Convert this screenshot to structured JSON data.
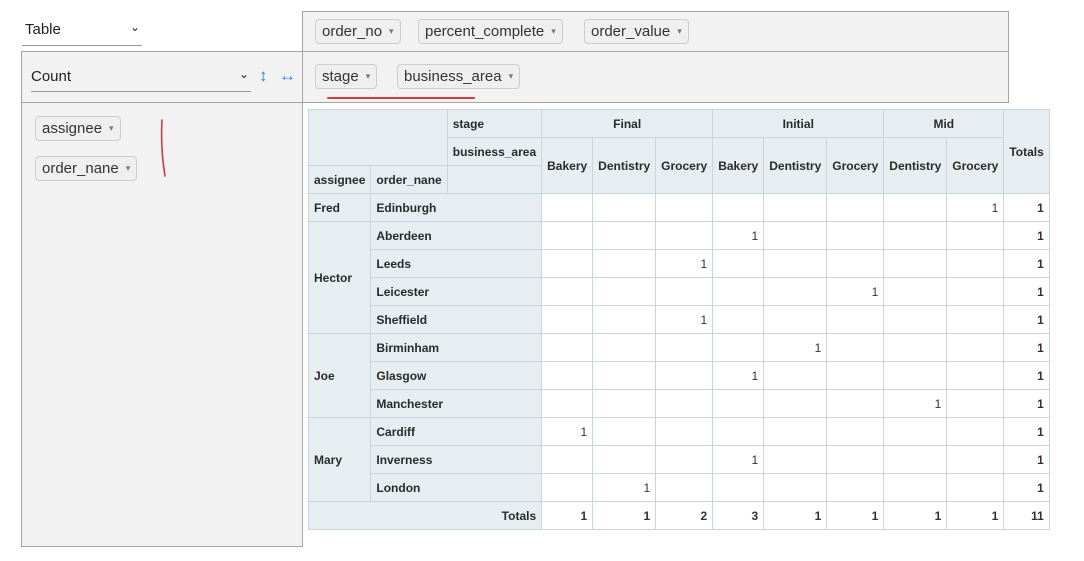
{
  "renderer": {
    "value": "Table"
  },
  "unused_attributes": [
    "order_no",
    "percent_complete",
    "order_value"
  ],
  "col_attributes": [
    "stage",
    "business_area"
  ],
  "row_attributes": [
    "assignee",
    "order_nane"
  ],
  "aggregator": {
    "value": "Count",
    "sort_rows_icon": "↕",
    "sort_cols_icon": "↔"
  },
  "icons": {
    "caret": "▾",
    "chevron": "⌄"
  },
  "colors": {
    "accent": "#3b7dd8",
    "header_bg": "#e6eef1",
    "annotation": "#d53a3a"
  },
  "table": {
    "col_axis_labels": [
      "stage",
      "business_area"
    ],
    "row_axis_labels": [
      "assignee",
      "order_nane"
    ],
    "stages": [
      {
        "label": "Final",
        "areas": [
          "Bakery",
          "Dentistry",
          "Grocery"
        ]
      },
      {
        "label": "Initial",
        "areas": [
          "Bakery",
          "Dentistry",
          "Grocery"
        ]
      },
      {
        "label": "Mid",
        "areas": [
          "Dentistry",
          "Grocery"
        ]
      }
    ],
    "totals_label": "Totals",
    "groups": [
      {
        "assignee": "Fred",
        "rows": [
          {
            "name": "Edinburgh",
            "cells": [
              "",
              "",
              "",
              "",
              "",
              "",
              "",
              "1"
            ],
            "total": "1"
          }
        ]
      },
      {
        "assignee": "Hector",
        "rows": [
          {
            "name": "Aberdeen",
            "cells": [
              "",
              "",
              "",
              "1",
              "",
              "",
              "",
              ""
            ],
            "total": "1"
          },
          {
            "name": "Leeds",
            "cells": [
              "",
              "",
              "1",
              "",
              "",
              "",
              "",
              ""
            ],
            "total": "1"
          },
          {
            "name": "Leicester",
            "cells": [
              "",
              "",
              "",
              "",
              "",
              "1",
              "",
              ""
            ],
            "total": "1"
          },
          {
            "name": "Sheffield",
            "cells": [
              "",
              "",
              "1",
              "",
              "",
              "",
              "",
              ""
            ],
            "total": "1"
          }
        ]
      },
      {
        "assignee": "Joe",
        "rows": [
          {
            "name": "Birminham",
            "cells": [
              "",
              "",
              "",
              "",
              "1",
              "",
              "",
              ""
            ],
            "total": "1"
          },
          {
            "name": "Glasgow",
            "cells": [
              "",
              "",
              "",
              "1",
              "",
              "",
              "",
              ""
            ],
            "total": "1"
          },
          {
            "name": "Manchester",
            "cells": [
              "",
              "",
              "",
              "",
              "",
              "",
              "1",
              ""
            ],
            "total": "1"
          }
        ]
      },
      {
        "assignee": "Mary",
        "rows": [
          {
            "name": "Cardiff",
            "cells": [
              "1",
              "",
              "",
              "",
              "",
              "",
              "",
              ""
            ],
            "total": "1"
          },
          {
            "name": "Inverness",
            "cells": [
              "",
              "",
              "",
              "1",
              "",
              "",
              "",
              ""
            ],
            "total": "1"
          },
          {
            "name": "London",
            "cells": [
              "",
              "1",
              "",
              "",
              "",
              "",
              "",
              ""
            ],
            "total": "1"
          }
        ]
      }
    ],
    "col_totals": [
      "1",
      "1",
      "2",
      "3",
      "1",
      "1",
      "1",
      "1"
    ],
    "grand_total": "11"
  }
}
